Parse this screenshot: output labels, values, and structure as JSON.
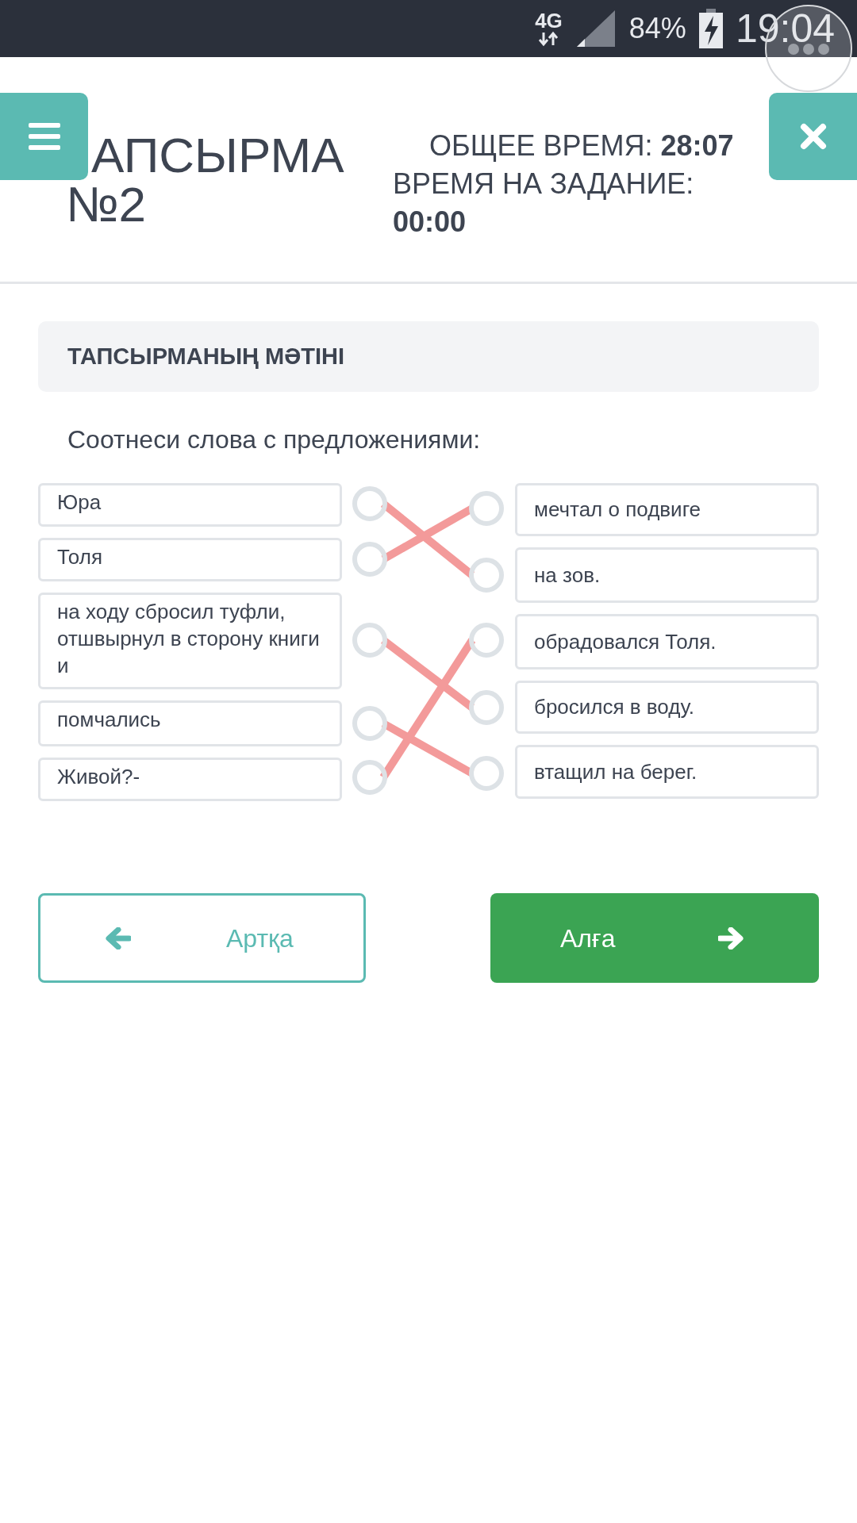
{
  "status_bar": {
    "network": "4G",
    "battery": "84%",
    "time": "19:04"
  },
  "header": {
    "title": "АПСЫРМА №2",
    "total_time": "ОБЩЕЕ ВРЕМЯ: **28:07**",
    "task_time_label": "ВРЕМЯ НА ЗАДАНИЕ:",
    "task_time": "00:00"
  },
  "task": {
    "heading": "ТАПСЫРМАНЫҢ МӘТІНІ",
    "instruction": "Соотнеси слова с предложениями:"
  },
  "left_items": [
    {
      "text": "Юра",
      "links": [
        false,
        true,
        false,
        false,
        false
      ]
    },
    {
      "text": "Толя",
      "links": [
        true,
        false,
        false,
        false,
        false
      ]
    },
    {
      "text": "на ходу сбросил туфли, отшвырнул в сторону книги и",
      "links": [
        false,
        false,
        false,
        true,
        false
      ]
    },
    {
      "text": "помчались",
      "links": [
        false,
        false,
        false,
        false,
        true
      ]
    },
    {
      "text": "Живой?-",
      "links": [
        false,
        false,
        true,
        false,
        false
      ]
    }
  ],
  "right_items": [
    {
      "text": "мечтал о подвиге"
    },
    {
      "text": "на зов."
    },
    {
      "text": "обрадовался Толя."
    },
    {
      "text": "бросился в воду."
    },
    {
      "text": "втащил на берег."
    }
  ],
  "buttons": {
    "back": "Артқа",
    "next": "Алға"
  }
}
